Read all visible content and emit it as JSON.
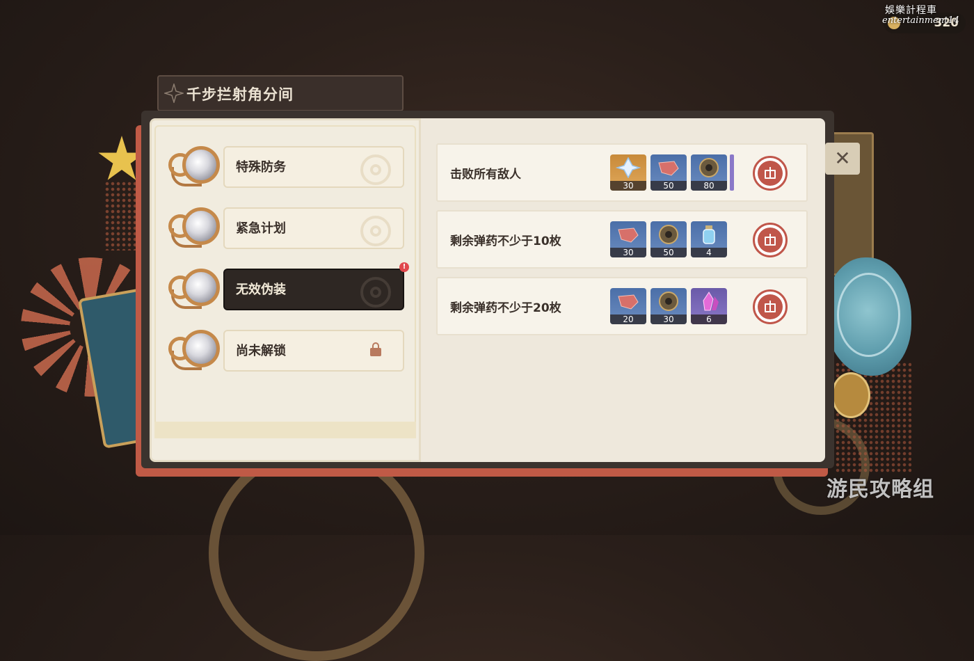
{
  "currency": {
    "value": "320",
    "icon": "coin-icon"
  },
  "watermark_top": {
    "main": "娛樂計程車",
    "sub": "entertainment14"
  },
  "title": "千步拦射角分间",
  "levels": [
    {
      "label": "特殊防务",
      "state": "completed"
    },
    {
      "label": "紧急计划",
      "state": "completed"
    },
    {
      "label": "无效伪装",
      "state": "selected",
      "alert": "!"
    },
    {
      "label": "尚未解锁",
      "state": "locked"
    }
  ],
  "tasks": [
    {
      "text": "击败所有敌人",
      "rewards": [
        {
          "icon": "primogem-icon",
          "count": "30",
          "rarity": "gold"
        },
        {
          "icon": "hero-wit-icon",
          "count": "50",
          "rarity": "blue"
        },
        {
          "icon": "mystic-ore-icon",
          "count": "80",
          "rarity": "blue"
        }
      ]
    },
    {
      "text": "剩余弹药不少于10枚",
      "rewards": [
        {
          "icon": "hero-wit-icon",
          "count": "30",
          "rarity": "blue"
        },
        {
          "icon": "mystic-ore-icon",
          "count": "50",
          "rarity": "blue"
        },
        {
          "icon": "potion-icon",
          "count": "4",
          "rarity": "blue"
        }
      ]
    },
    {
      "text": "剩余弹药不少于20枚",
      "rewards": [
        {
          "icon": "hero-wit-icon",
          "count": "20",
          "rarity": "blue"
        },
        {
          "icon": "mystic-ore-icon",
          "count": "30",
          "rarity": "blue"
        },
        {
          "icon": "crystal-icon",
          "count": "6",
          "rarity": "purple"
        }
      ]
    }
  ],
  "close_label": "✕",
  "watermark_bottom": "游民攻略组",
  "colors": {
    "claim": "#c0564a",
    "page": "#eee8dc",
    "active_level": "#2e2723"
  }
}
